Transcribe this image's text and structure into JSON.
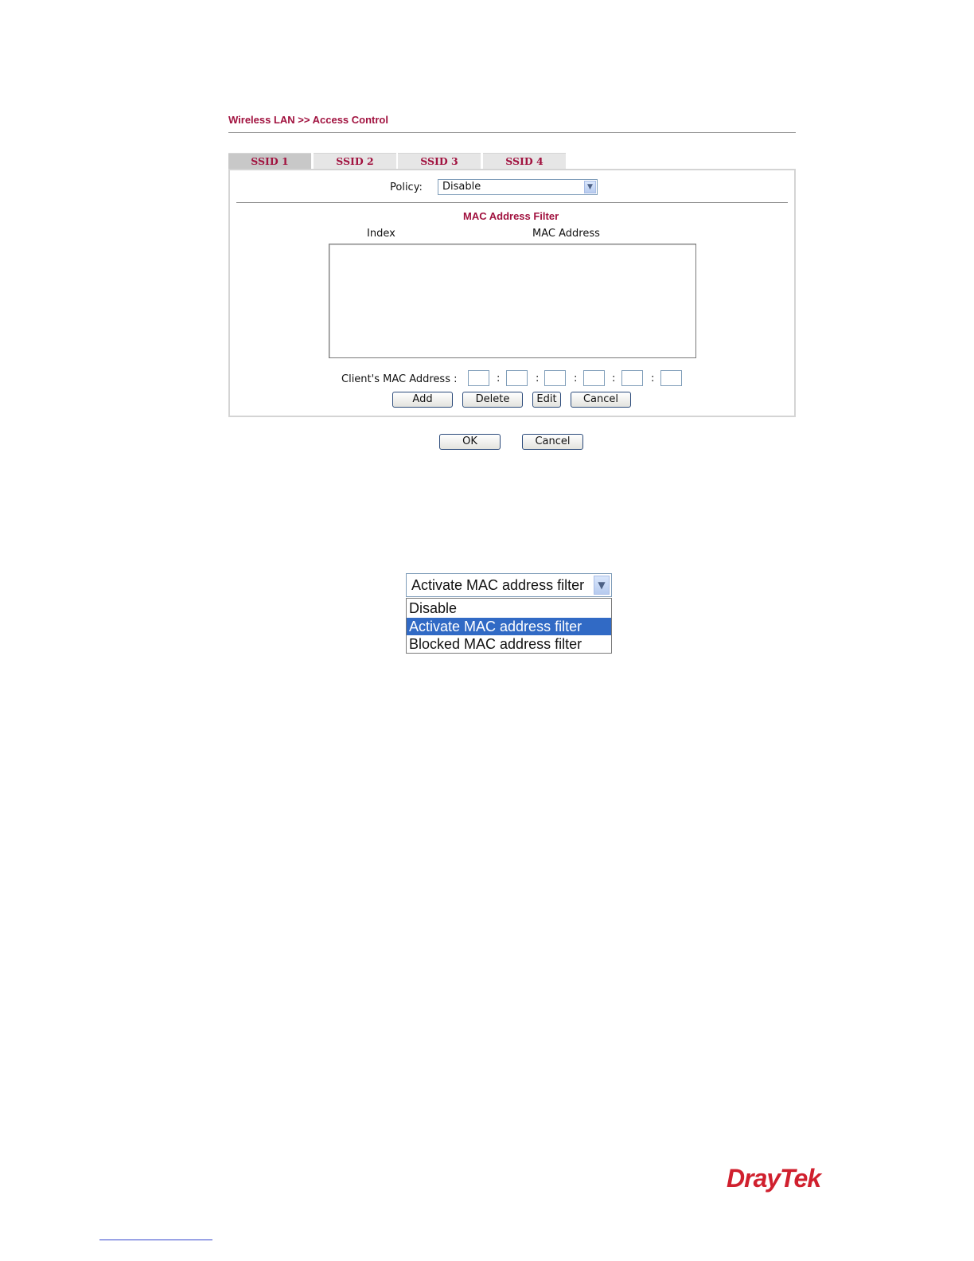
{
  "breadcrumb": "Wireless LAN >> Access Control",
  "tabs": [
    "SSID 1",
    "SSID 2",
    "SSID 3",
    "SSID 4"
  ],
  "active_tab": "SSID 1",
  "policy": {
    "label": "Policy:",
    "value": "Disable"
  },
  "mac_filter": {
    "title": "MAC Address Filter",
    "columns": [
      "Index",
      "MAC Address"
    ],
    "entries": [],
    "client_mac_label": "Client's MAC Address :",
    "separator": ":"
  },
  "buttons": {
    "add": "Add",
    "delete": "Delete",
    "edit": "Edit",
    "cancel": "Cancel",
    "ok": "OK",
    "page_cancel": "Cancel"
  },
  "policy_dropdown": {
    "selected": "Activate MAC address filter",
    "options": [
      "Disable",
      "Activate MAC address filter",
      "Blocked MAC address filter"
    ],
    "highlighted_index": 1
  },
  "brand": "DrayTek",
  "colors": {
    "accent": "#a1123f",
    "selection": "#316ac5",
    "brand": "#d0202e"
  },
  "icons": [
    "chevron-down-icon"
  ]
}
